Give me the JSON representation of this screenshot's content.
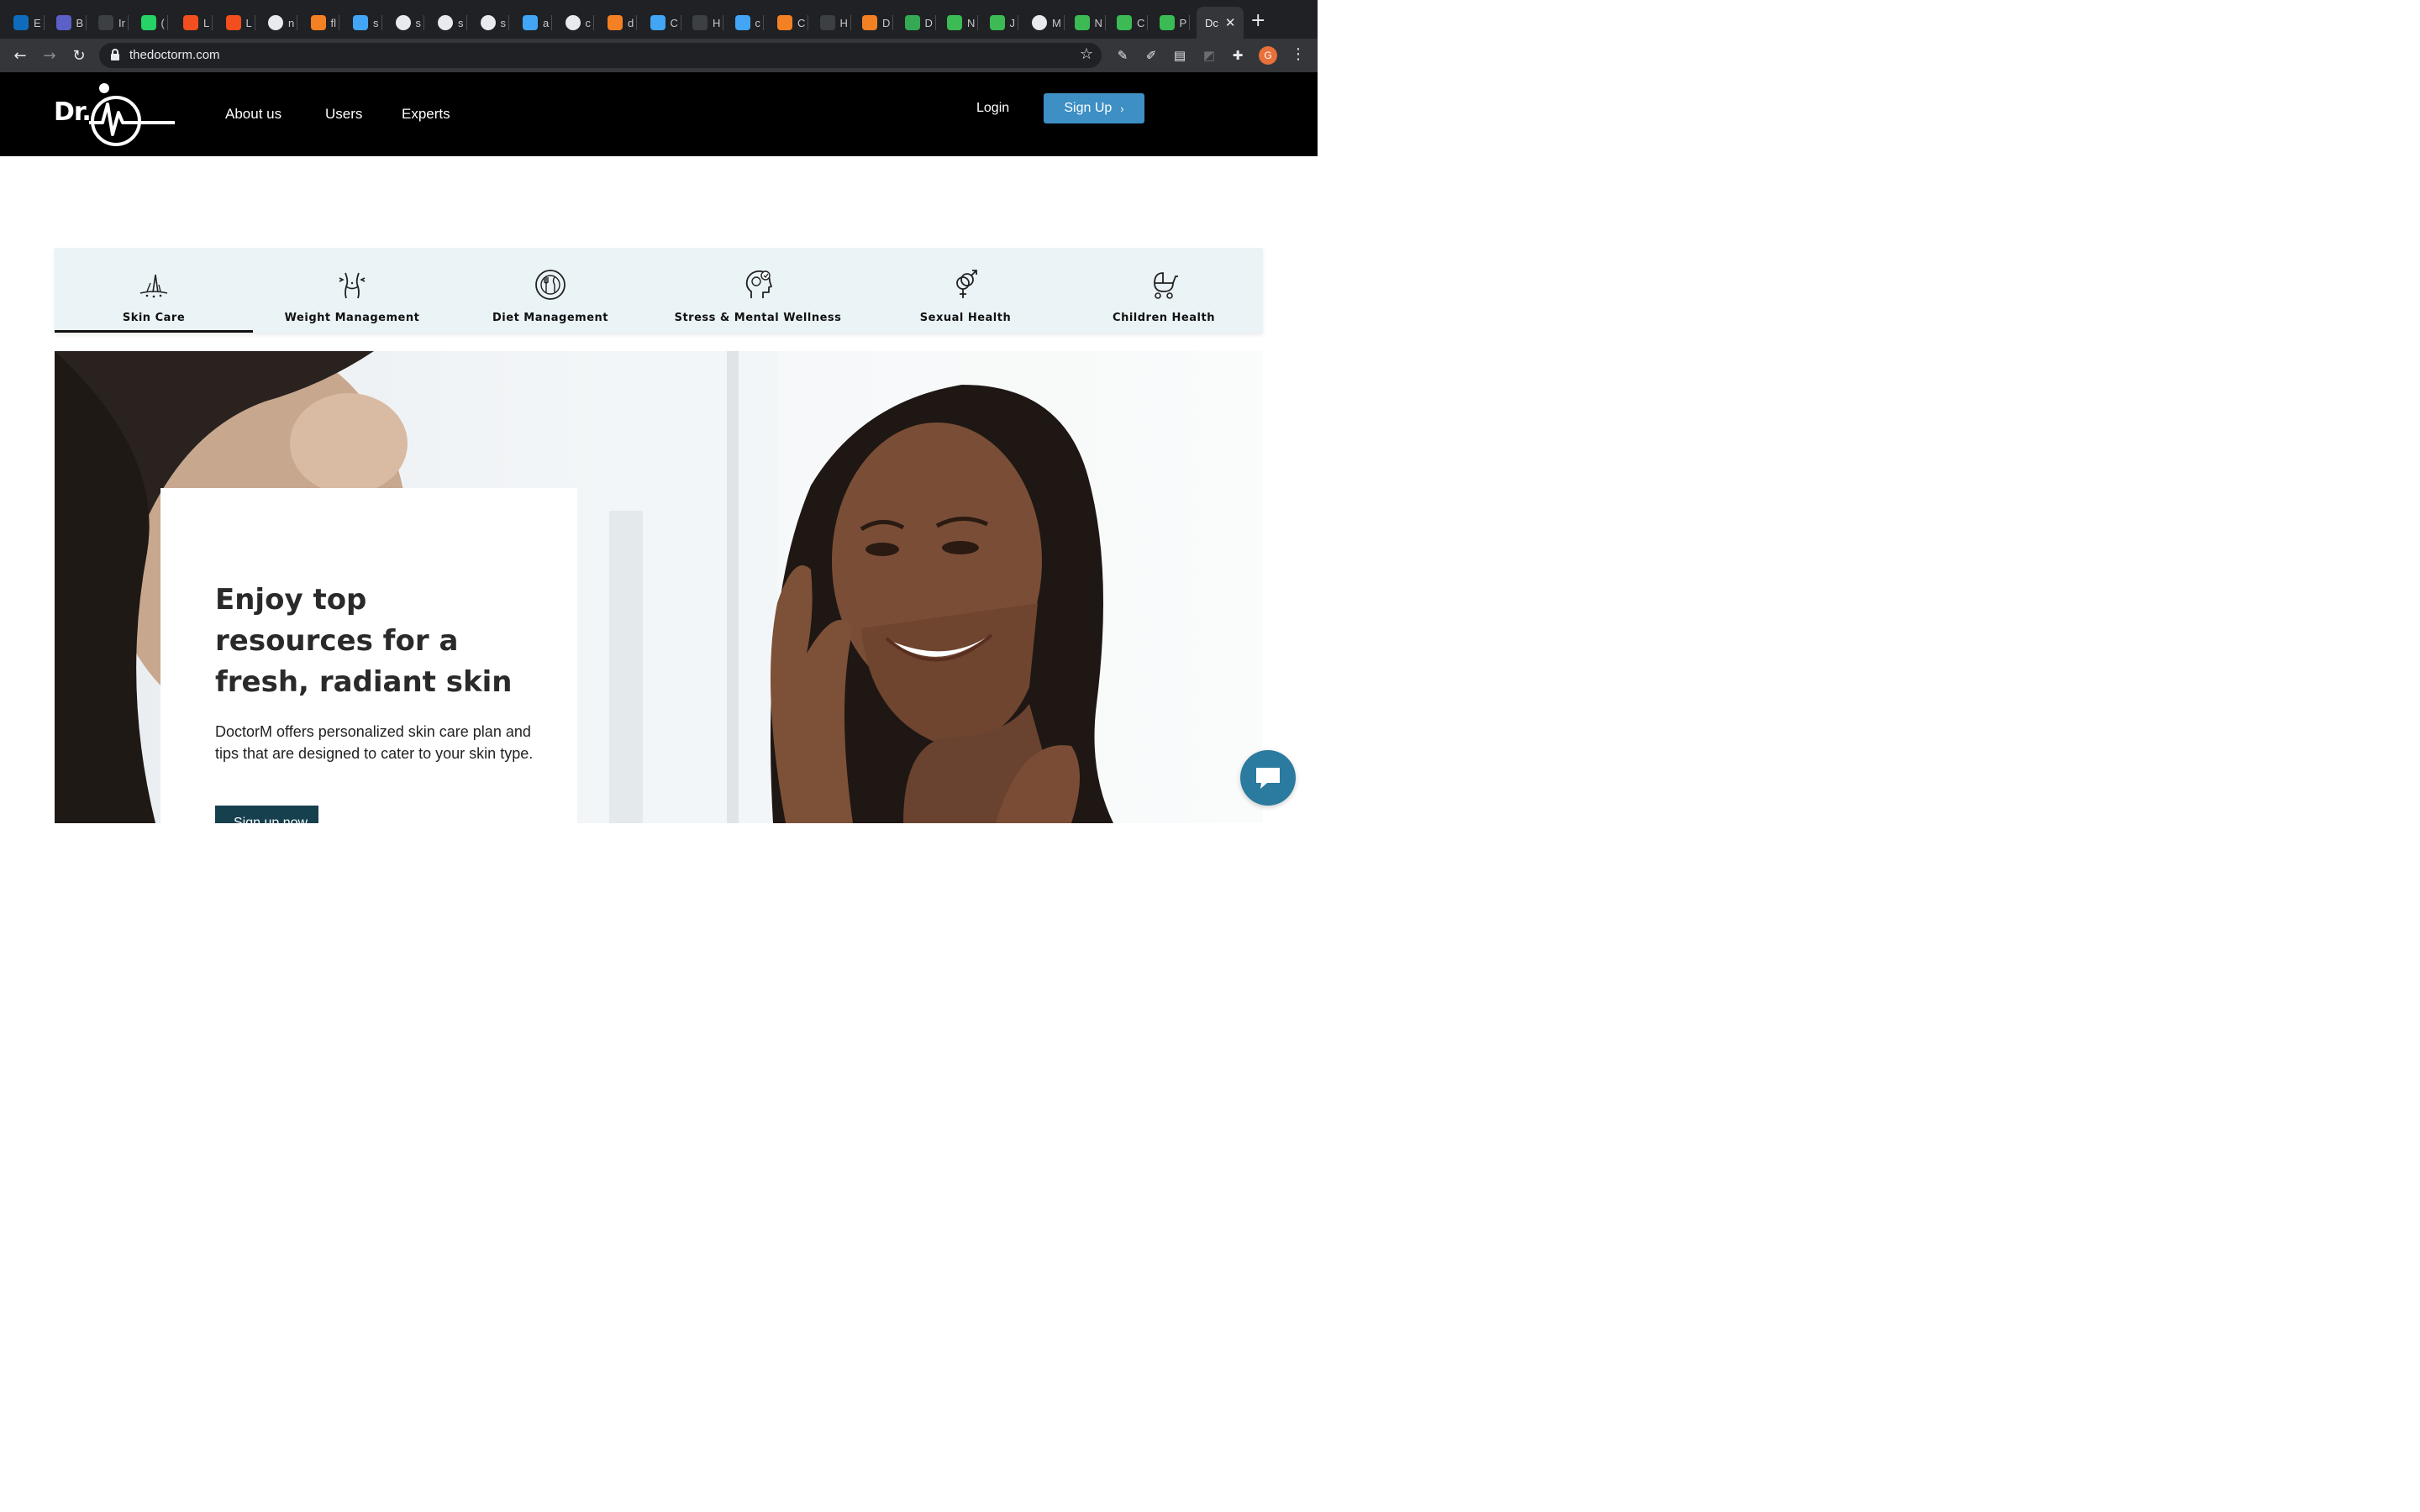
{
  "browser": {
    "tabs": [
      {
        "letter": "E",
        "icon": "outlook-icon",
        "color": "#0f6cbd"
      },
      {
        "letter": "B",
        "icon": "teams-icon",
        "color": "#5b5fc7"
      },
      {
        "letter": "Ir",
        "icon": "generic-site-icon",
        "color": "#3c4043"
      },
      {
        "letter": "(",
        "icon": "whatsapp-icon",
        "color": "#25d366"
      },
      {
        "letter": "L",
        "icon": "figma-icon",
        "color": "#f24e1e"
      },
      {
        "letter": "L",
        "icon": "figma-icon",
        "color": "#f24e1e"
      },
      {
        "letter": "n",
        "icon": "google-icon",
        "color": "#ffffff"
      },
      {
        "letter": "fl",
        "icon": "stackoverflow-icon",
        "color": "#f48024"
      },
      {
        "letter": "s",
        "icon": "flutter-icon",
        "color": "#42a5f5"
      },
      {
        "letter": "s",
        "icon": "github-icon",
        "color": "#ffffff"
      },
      {
        "letter": "s",
        "icon": "github-icon",
        "color": "#ffffff"
      },
      {
        "letter": "s",
        "icon": "github-icon",
        "color": "#ffffff"
      },
      {
        "letter": "a",
        "icon": "flutter-icon",
        "color": "#42a5f5"
      },
      {
        "letter": "c",
        "icon": "google-icon",
        "color": "#ffffff"
      },
      {
        "letter": "d",
        "icon": "stackoverflow-icon",
        "color": "#f48024"
      },
      {
        "letter": "C",
        "icon": "flutter-icon",
        "color": "#42a5f5"
      },
      {
        "letter": "H",
        "icon": "github-icon",
        "color": "#3c4043"
      },
      {
        "letter": "c",
        "icon": "flutter-icon",
        "color": "#42a5f5"
      },
      {
        "letter": "C",
        "icon": "stackoverflow-icon",
        "color": "#f48024"
      },
      {
        "letter": "H",
        "icon": "github-icon",
        "color": "#3c4043"
      },
      {
        "letter": "D",
        "icon": "stackoverflow-icon",
        "color": "#f48024"
      },
      {
        "letter": "D",
        "icon": "play-store-icon",
        "color": "#34a853"
      },
      {
        "letter": "N",
        "icon": "grid-icon",
        "color": "#3cba54"
      },
      {
        "letter": "J",
        "icon": "grid-icon",
        "color": "#3cba54"
      },
      {
        "letter": "M",
        "icon": "spinner-icon",
        "color": "#ffffff"
      },
      {
        "letter": "N",
        "icon": "grid-icon",
        "color": "#3cba54"
      },
      {
        "letter": "C",
        "icon": "grid-icon",
        "color": "#3cba54"
      },
      {
        "letter": "P",
        "icon": "grid-icon",
        "color": "#3cba54"
      }
    ],
    "active_tab": "Dc",
    "url": "thedoctorm.com",
    "profile_initial": "G"
  },
  "site": {
    "logo_text": "Dr.",
    "nav": {
      "about": "About us",
      "users": "Users",
      "experts": "Experts"
    },
    "login": "Login",
    "signup": "Sign Up",
    "signup_chevron": "›",
    "colors": {
      "header_bg": "#000000",
      "signup_bg": "#3d8fc4",
      "tabbar_bg": "#eaf3f6",
      "cta_bg": "#17404f",
      "chat_bg": "#2b7a9f"
    }
  },
  "categories": [
    {
      "label": "Skin Care",
      "icon": "skin-care-icon",
      "active": true
    },
    {
      "label": "Weight Management",
      "icon": "weight-management-icon",
      "active": false
    },
    {
      "label": "Diet Management",
      "icon": "diet-management-icon",
      "active": false
    },
    {
      "label": "Stress & Mental Wellness",
      "icon": "mental-wellness-icon",
      "active": false
    },
    {
      "label": "Sexual Health",
      "icon": "sexual-health-icon",
      "active": false
    },
    {
      "label": "Children Health",
      "icon": "children-health-icon",
      "active": false
    }
  ],
  "hero": {
    "title": "Enjoy top resources for a fresh, radiant skin",
    "description": "DoctorM offers personalized skin care plan and tips that are designed to cater to your skin type.",
    "cta": "Sign up now",
    "image": "woman-touching-face-photo"
  }
}
